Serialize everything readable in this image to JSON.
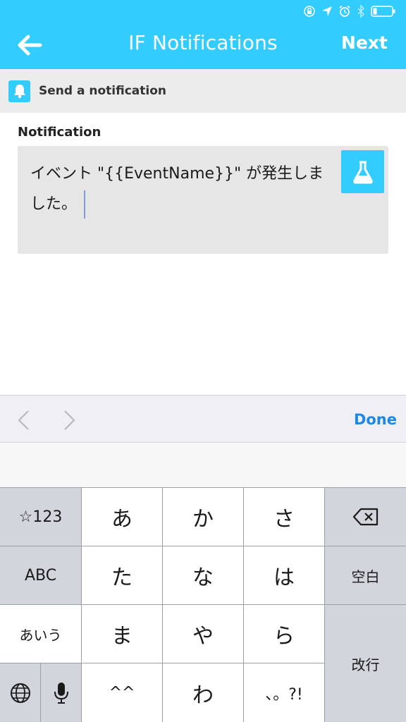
{
  "header": {
    "title": "IF Notifications",
    "next_label": "Next",
    "back_icon": "arrow-left-icon",
    "accent_color": "#33ccff"
  },
  "status_bar": {
    "icons": [
      "rotation-lock-icon",
      "location-arrow-icon",
      "alarm-icon",
      "bluetooth-icon",
      "battery-icon"
    ]
  },
  "action": {
    "icon": "bell-icon",
    "label": "Send a notification"
  },
  "field": {
    "label": "Notification",
    "value_line1": "イベント \"{{EventName}}\" が発生しま",
    "value_line2": "した。",
    "ingredient_icon": "flask-icon"
  },
  "accessory": {
    "prev_icon": "chevron-left-icon",
    "next_icon": "chevron-right-icon",
    "done_label": "Done",
    "done_color": "#1e88e5"
  },
  "keyboard": {
    "left_column": [
      "☆123",
      "ABC",
      "あいう"
    ],
    "rows": [
      [
        "あ",
        "か",
        "さ"
      ],
      [
        "た",
        "な",
        "は"
      ],
      [
        "ま",
        "や",
        "ら"
      ],
      [
        "^^",
        "わ",
        "、。?!"
      ]
    ],
    "right_column": [
      "delete-icon",
      "空白",
      "改行"
    ],
    "bottom_left_icons": [
      "globe-icon",
      "microphone-icon"
    ]
  }
}
